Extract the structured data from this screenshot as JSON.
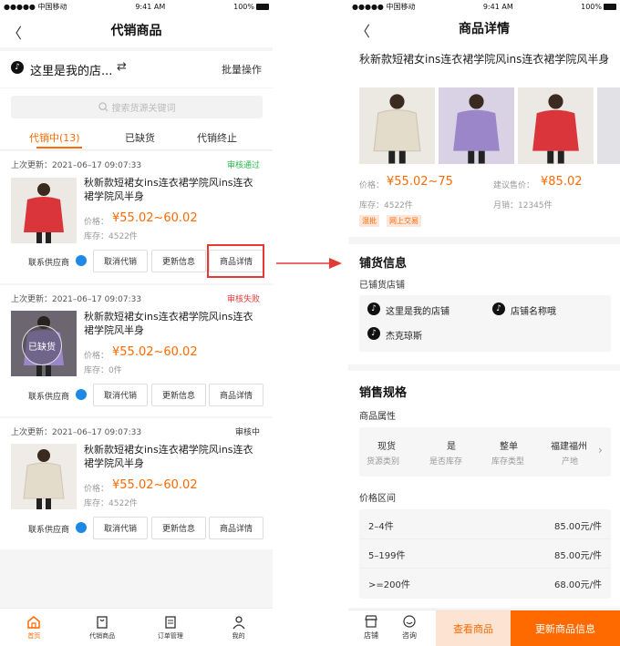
{
  "status": {
    "carrier": "●●●●● 中国移动",
    "time": "9:41 AM",
    "battery": "100%"
  },
  "left": {
    "title": "代销商品",
    "store_name": "这里是我的店...",
    "swap_symbol": "⇄",
    "batch_label": "批量操作",
    "search_placeholder": "搜索货源关键词",
    "tabs": [
      "代销中(13)",
      "已缺货",
      "代销终止"
    ],
    "products": [
      {
        "updated": "上次更新：2021–06–17  09:07:33",
        "status": "审核通过",
        "status_color": "#2db84d",
        "title": "秋新款短裙女ins连衣裙学院风ins连衣裙学院风半身",
        "price_label": "价格：",
        "price": "¥55.02~60.02",
        "stock": "库存：4522件",
        "overlay": "",
        "coat": "#d9353a",
        "btn_supplier": "联系供应商",
        "btn_cancel": "取消代销",
        "btn_update": "更新信息",
        "btn_detail": "商品详情"
      },
      {
        "updated": "上次更新：2021–06–17  09:07:33",
        "status": "审核失败",
        "status_color": "#e23b3b",
        "title": "秋新款短裙女ins连衣裙学院风ins连衣裙学院风半身",
        "price_label": "价格：",
        "price": "¥55.02~60.02",
        "stock": "库存：0件",
        "overlay": "已缺货",
        "coat": "#9a86c8",
        "btn_supplier": "联系供应商",
        "btn_cancel": "取消代销",
        "btn_update": "更新信息",
        "btn_detail": "商品详情"
      },
      {
        "updated": "上次更新：2021–06–17  09:07:33",
        "status": "审核中",
        "status_color": "#333333",
        "title": "秋新款短裙女ins连衣裙学院风ins连衣裙学院风半身",
        "price_label": "价格：",
        "price": "¥55.02~60.02",
        "stock": "库存：4522件",
        "overlay": "",
        "coat": "#e8e0d0",
        "btn_supplier": "联系供应商",
        "btn_cancel": "取消代销",
        "btn_update": "更新信息",
        "btn_detail": "商品详情"
      }
    ],
    "tabbar": [
      "首页",
      "代销商品",
      "订单管理",
      "我的"
    ]
  },
  "right": {
    "title": "商品详情",
    "product_title": "秋新款短裙女ins连衣裙学院风ins连衣裙学院风半身",
    "price_label": "价格：",
    "price": "¥55.02~75",
    "suggest_label": "建议售价：",
    "suggest_price": "¥85.02",
    "stock": "库存：4522件",
    "monthly": "月销：12345件",
    "tags": [
      "混批",
      "网上交易"
    ],
    "dist_title": "铺货信息",
    "dist_sub": "已铺货店铺",
    "stores": [
      "这里是我的店铺",
      "店铺名称哦",
      "杰克琼斯"
    ],
    "spec_title": "销售规格",
    "attr_title": "商品属性",
    "attrs": [
      {
        "v": "现货",
        "k": "货源类别"
      },
      {
        "v": "是",
        "k": "是否库存"
      },
      {
        "v": "整单",
        "k": "库存类型"
      },
      {
        "v": "福建福州",
        "k": "产地"
      }
    ],
    "range_title": "价格区间",
    "ranges": [
      {
        "q": "2–4件",
        "p": "85.00元/件"
      },
      {
        "q": "5–199件",
        "p": "85.00元/件"
      },
      {
        "q": ">=200件",
        "p": "68.00元/件"
      }
    ],
    "bottom": {
      "store": "店铺",
      "consult": "咨询",
      "view": "查看商品",
      "update": "更新商品信息"
    }
  },
  "colors": {
    "accent": "#ff6a00",
    "highlight_box": "#e53935",
    "arrow": "#e53935"
  }
}
